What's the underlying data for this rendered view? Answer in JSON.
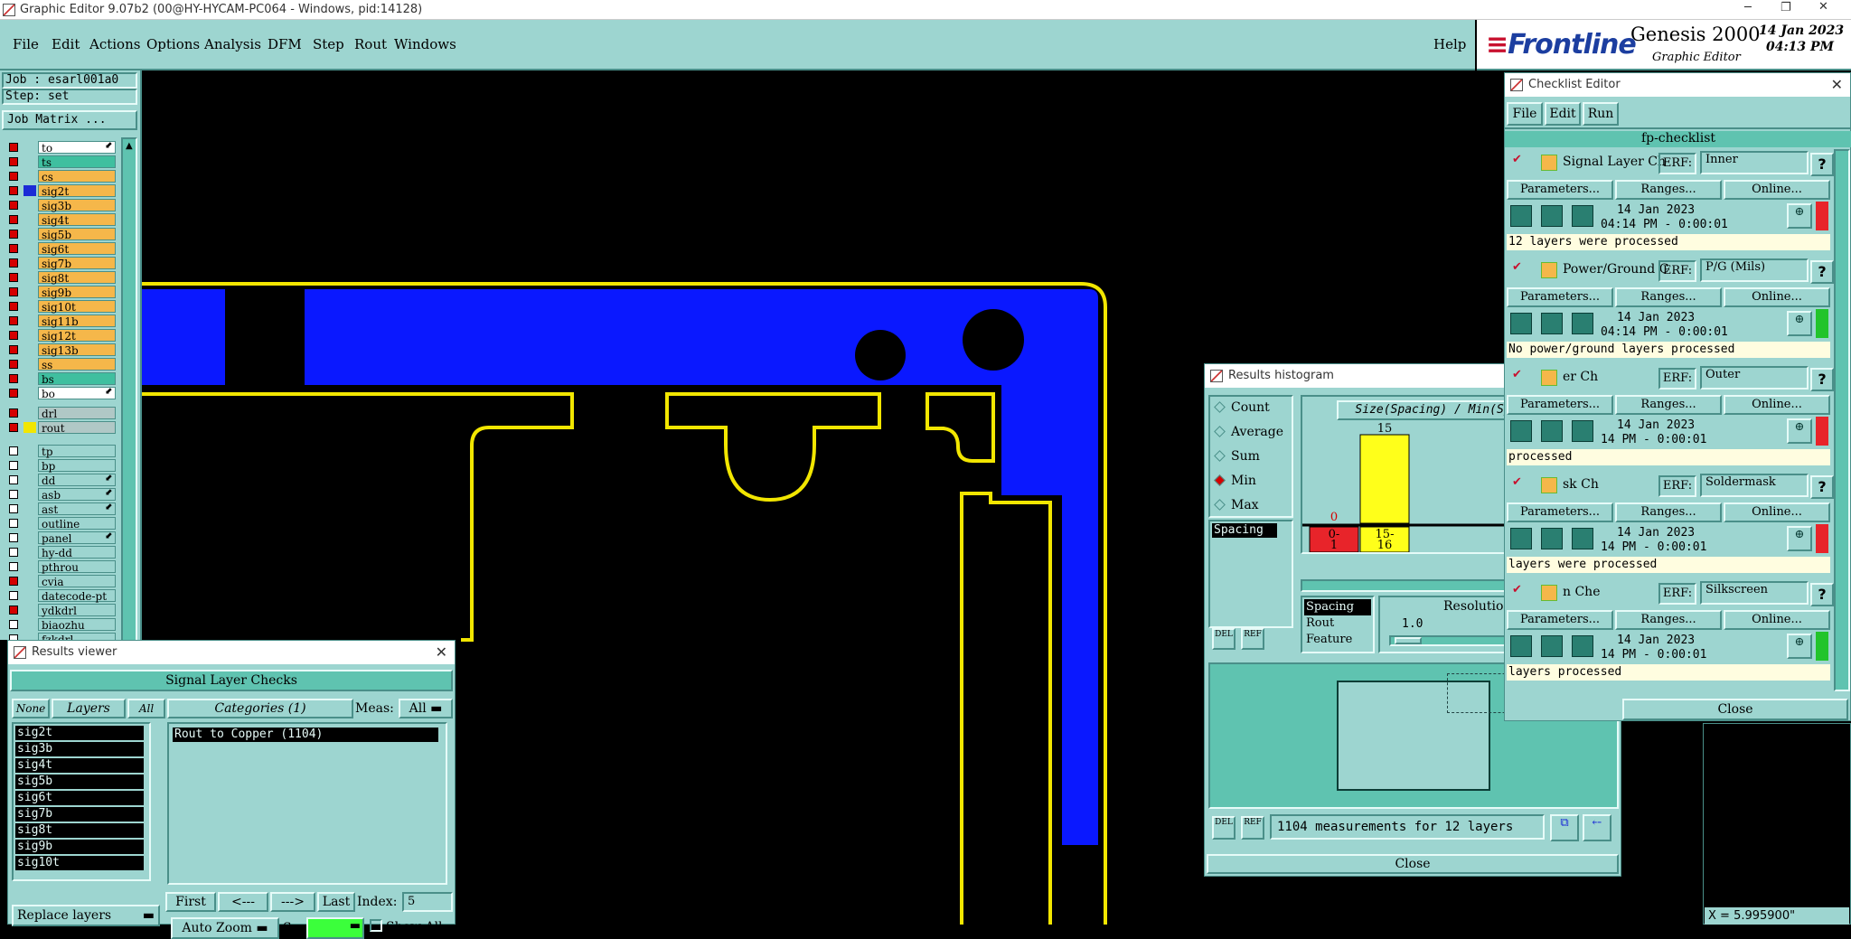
{
  "window": {
    "title": "Graphic Editor 9.07b2 (00@HY-HYCAM-PC064 - Windows, pid:14128)"
  },
  "menu": [
    "File",
    "Edit",
    "Actions",
    "Options",
    "Analysis",
    "DFM",
    "Step",
    "Rout",
    "Windows"
  ],
  "help_label": "Help",
  "brand": {
    "logo": "Frontline",
    "product": "Genesis 2000",
    "subtitle": "Graphic Editor",
    "date": "14 Jan 2023",
    "time": "04:13 PM"
  },
  "job": {
    "job_label": "Job : esarl001a0",
    "step_label": "Step: set",
    "matrix_button": "Job Matrix ..."
  },
  "layers_board": [
    {
      "name": "to",
      "color": "#ffffff",
      "cb": "red",
      "arrow": true
    },
    {
      "name": "ts",
      "color": "#3fbf9f",
      "cb": "red"
    },
    {
      "name": "cs",
      "color": "#f5b74a",
      "cb": "red"
    },
    {
      "name": "sig2t",
      "color": "#f5b74a",
      "cb": "red",
      "active": true
    },
    {
      "name": "sig3b",
      "color": "#f5b74a",
      "cb": "red"
    },
    {
      "name": "sig4t",
      "color": "#f5b74a",
      "cb": "red"
    },
    {
      "name": "sig5b",
      "color": "#f5b74a",
      "cb": "red"
    },
    {
      "name": "sig6t",
      "color": "#f5b74a",
      "cb": "red"
    },
    {
      "name": "sig7b",
      "color": "#f5b74a",
      "cb": "red"
    },
    {
      "name": "sig8t",
      "color": "#f5b74a",
      "cb": "red"
    },
    {
      "name": "sig9b",
      "color": "#f5b74a",
      "cb": "red"
    },
    {
      "name": "sig10t",
      "color": "#f5b74a",
      "cb": "red"
    },
    {
      "name": "sig11b",
      "color": "#f5b74a",
      "cb": "red"
    },
    {
      "name": "sig12t",
      "color": "#f5b74a",
      "cb": "red"
    },
    {
      "name": "sig13b",
      "color": "#f5b74a",
      "cb": "red"
    },
    {
      "name": "ss",
      "color": "#f5b74a",
      "cb": "red"
    },
    {
      "name": "bs",
      "color": "#3fbf9f",
      "cb": "red"
    },
    {
      "name": "bo",
      "color": "#ffffff",
      "cb": "red",
      "arrow": true
    }
  ],
  "layers_drill": [
    {
      "name": "drl",
      "color": "#b0c8c6",
      "cb": "red"
    },
    {
      "name": "rout",
      "color": "#b0c8c6",
      "cb": "red",
      "swatch": "#f2e600"
    }
  ],
  "layers_misc": [
    {
      "name": "tp",
      "cb": "white"
    },
    {
      "name": "bp",
      "cb": "white"
    },
    {
      "name": "dd",
      "cb": "white",
      "arrow": true
    },
    {
      "name": "asb",
      "cb": "white",
      "arrow": true
    },
    {
      "name": "ast",
      "cb": "white",
      "arrow": true
    },
    {
      "name": "outline",
      "cb": "white"
    },
    {
      "name": "panel",
      "cb": "white",
      "arrow": true
    },
    {
      "name": "hy-dd",
      "cb": "white"
    },
    {
      "name": "pthrou",
      "cb": "white"
    },
    {
      "name": "cvia",
      "cb": "red"
    },
    {
      "name": "datecode-pt",
      "cb": "white"
    },
    {
      "name": "ydkdrl",
      "cb": "red"
    },
    {
      "name": "biaozhu",
      "cb": "white"
    },
    {
      "name": "fzkdrl",
      "cb": "white"
    }
  ],
  "results_viewer": {
    "title": "Results viewer",
    "header": "Signal Layer Checks",
    "none": "None",
    "layers": "Layers",
    "all": "All",
    "categories": "Categories (1)",
    "meas_label": "Meas:",
    "meas_value": "All",
    "layer_items": [
      "sig2t",
      "sig3b",
      "sig4t",
      "sig5b",
      "sig6t",
      "sig7b",
      "sig8t",
      "sig9b",
      "sig10t"
    ],
    "category_items": [
      "Rout to Copper (1104)"
    ],
    "first": "First",
    "prev": "<---",
    "next": "--->",
    "last": "Last",
    "index_label": "Index:",
    "index_value": "5",
    "auto_zoom": "Auto Zoom",
    "sv": "Sv:",
    "show_all": "Show All",
    "replace": "Replace layers"
  },
  "histogram": {
    "title": "Results histogram",
    "options": [
      "Count",
      "Average",
      "Sum",
      "Min",
      "Max"
    ],
    "selected": "Min",
    "list_item": "Spacing",
    "chart_title": "Size(Spacing) / Min(Spacing)",
    "bins": [
      {
        "label": "0-\n1",
        "value": 0,
        "color": "#e8242a"
      },
      {
        "label": "15-\n16",
        "value": 15,
        "color": "#ffff1a"
      }
    ],
    "types": [
      "Spacing",
      "Rout",
      "Feature"
    ],
    "resolution_label": "Resolution",
    "resolution_value": "1.0",
    "status": "1104 measurements for 12 layers",
    "close": "Close",
    "del": "DEL",
    "ref": "REF"
  },
  "checklist": {
    "title": "Checklist Editor",
    "menu": [
      "File",
      "Edit",
      "Run"
    ],
    "name": "fp-checklist",
    "erf_label": "ERF:",
    "params_btn": "Parameters...",
    "ranges_btn": "Ranges...",
    "online_btn": "Online...",
    "items": [
      {
        "name": "Signal Layer Ch",
        "erf": "Inner",
        "date": "14 Jan 2023",
        "time": "04:14 PM - 0:00:01",
        "msg": "12 layers were processed",
        "status": "#e8242a"
      },
      {
        "name": "Power/Ground C",
        "erf": "P/G (Mils)",
        "date": "14 Jan 2023",
        "time": "04:14 PM - 0:00:01",
        "msg": "No power/ground layers processed",
        "status": "#22c42b"
      },
      {
        "name": "er Ch",
        "erf": "Outer",
        "date": "14 Jan 2023",
        "time": "14 PM - 0:00:01",
        "msg": "processed",
        "status": "#e8242a"
      },
      {
        "name": "sk Ch",
        "erf": "Soldermask",
        "date": "14 Jan 2023",
        "time": "14 PM - 0:00:01",
        "msg": "layers were processed",
        "status": "#e8242a"
      },
      {
        "name": "n Che",
        "erf": "Silkscreen",
        "date": "14 Jan 2023",
        "time": "14 PM - 0:00:01",
        "msg": "layers processed",
        "status": "#22c42b"
      }
    ],
    "close": "Close"
  },
  "coord_readout": "X = 5.995900\""
}
